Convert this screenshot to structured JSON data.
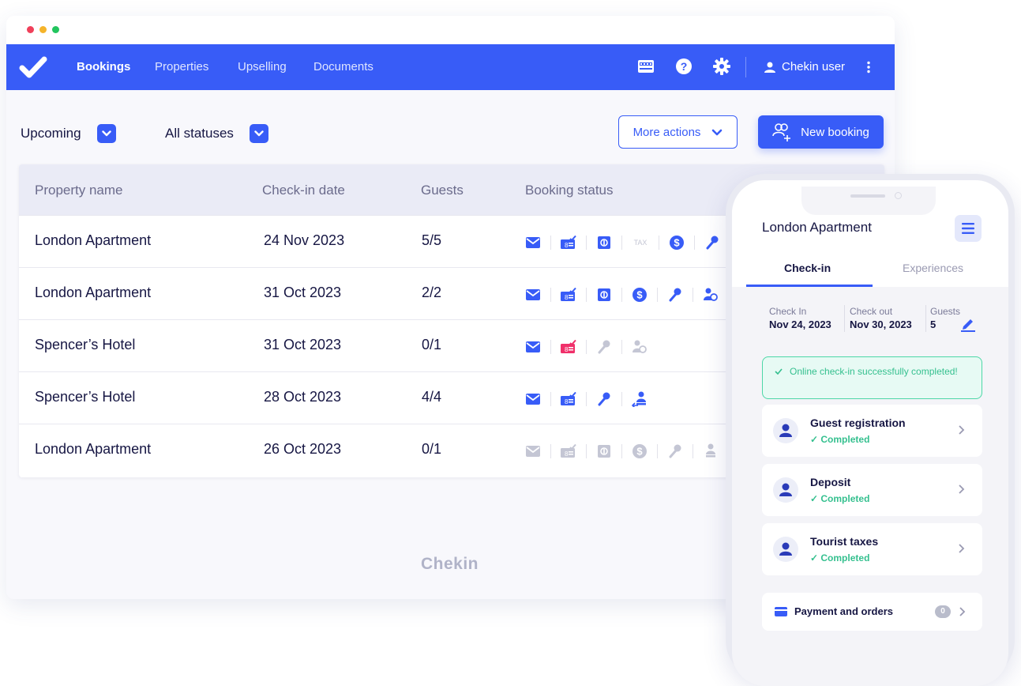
{
  "nav": {
    "links": [
      "Bookings",
      "Properties",
      "Upselling",
      "Documents"
    ],
    "user": "Chekin user"
  },
  "filters": {
    "period": "Upcoming",
    "status": "All statuses"
  },
  "actions": {
    "more": "More actions",
    "new_booking": "New booking"
  },
  "table": {
    "headers": [
      "Property name",
      "Check-in date",
      "Guests",
      "Booking status"
    ],
    "rows": [
      {
        "property": "London Apartment",
        "date": "24 Nov 2023",
        "guests": "5/5"
      },
      {
        "property": "London Apartment",
        "date": "31 Oct 2023",
        "guests": "2/2"
      },
      {
        "property": "Spencer’s Hotel",
        "date": "31 Oct 2023",
        "guests": "0/1"
      },
      {
        "property": "Spencer’s Hotel",
        "date": "28 Oct 2023",
        "guests": "4/4"
      },
      {
        "property": "London Apartment",
        "date": "26 Oct 2023",
        "guests": "0/1"
      }
    ],
    "tax_label": "TAX"
  },
  "watermark": "Chekin",
  "phone": {
    "title": "London Apartment",
    "tabs": [
      "Check-in",
      "Experiences"
    ],
    "checkin_label": "Check In",
    "checkin_value": "Nov 24, 2023",
    "checkout_label": "Check out",
    "checkout_value": "Nov 30, 2023",
    "guests_label": "Guests",
    "guests_value": "5",
    "alert": "Online check-in successfully completed!",
    "cards": [
      {
        "title": "Guest registration",
        "status": "Completed"
      },
      {
        "title": "Deposit",
        "status": "Completed"
      },
      {
        "title": "Tourist taxes",
        "status": "Completed"
      }
    ],
    "payment_label": "Payment and orders",
    "payment_count": "0"
  },
  "colors": {
    "brand": "#385cf7",
    "success": "#35c08f",
    "alert_pink": "#f0306a",
    "muted_icon": "#c4c6d4"
  }
}
